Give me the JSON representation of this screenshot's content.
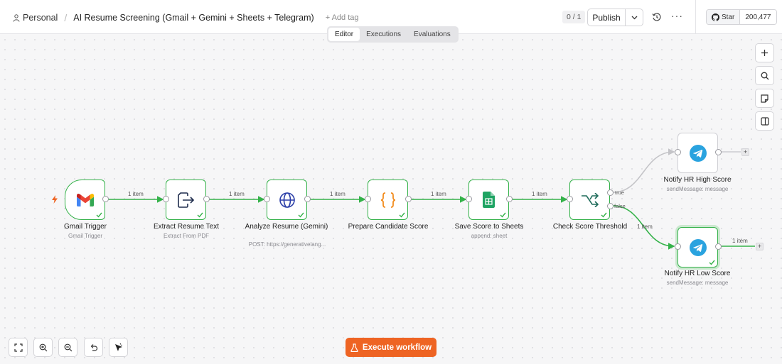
{
  "header": {
    "project": "Personal",
    "workflow_title": "AI Resume Screening (Gmail + Gemini + Sheets + Telegram)",
    "add_tag": "+ Add tag",
    "counter": "0 / 1",
    "publish_label": "Publish",
    "more_label": "···",
    "github": {
      "star_label": "Star",
      "star_count": "200,477"
    }
  },
  "tabs": [
    "Editor",
    "Executions",
    "Evaluations"
  ],
  "active_tab": "Editor",
  "nodes": [
    {
      "name": "Gmail Trigger",
      "subtitle": "Gmail Trigger",
      "icon": "gmail-icon",
      "status": "success"
    },
    {
      "name": "Extract Resume Text",
      "subtitle": "Extract From PDF",
      "icon": "file-export-icon",
      "status": "success"
    },
    {
      "name": "Analyze Resume (Gemini)",
      "subtitle": "POST: https://generativelang...",
      "icon": "globe-icon",
      "status": "success"
    },
    {
      "name": "Prepare Candidate Score",
      "subtitle": "",
      "icon": "code-braces-icon",
      "status": "success"
    },
    {
      "name": "Save Score to Sheets",
      "subtitle": "append: sheet",
      "icon": "google-sheets-icon",
      "status": "success"
    },
    {
      "name": "Check Score Threshold",
      "subtitle": "",
      "icon": "if-branch-icon",
      "status": "success"
    },
    {
      "name": "Notify HR High Score",
      "subtitle": "sendMessage: message",
      "icon": "telegram-icon",
      "status": "idle"
    },
    {
      "name": "Notify HR Low Score",
      "subtitle": "sendMessage: message",
      "icon": "telegram-icon",
      "status": "success"
    }
  ],
  "edge_labels": {
    "item": "1 item",
    "true": "true",
    "false": "false"
  },
  "canvas_tools_right": [
    "zoom-in-plus-icon",
    "search-icon",
    "sticky-note-icon",
    "panel-toggle-icon"
  ],
  "canvas_tools_bottom": [
    "fit-view-icon",
    "zoom-in-icon",
    "zoom-out-icon",
    "undo-icon",
    "tidy-up-icon"
  ],
  "execute_button": "Execute workflow",
  "colors": {
    "success": "#35b24a",
    "accent": "#ee6423",
    "idle_edge": "#c4c4c8"
  }
}
